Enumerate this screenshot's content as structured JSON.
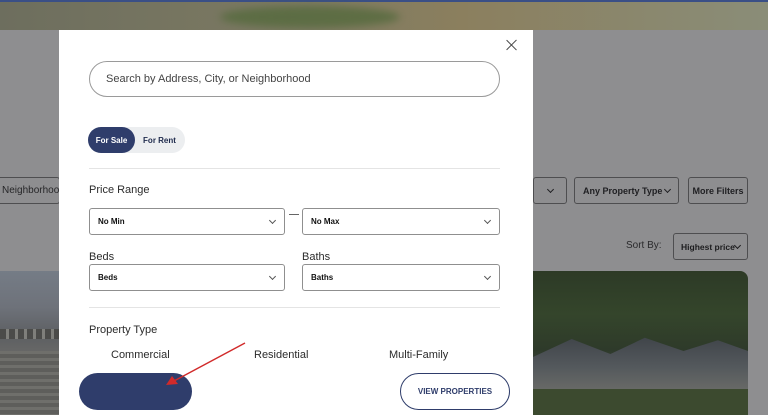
{
  "background": {
    "neighborhood_text": "Neighborhoo",
    "property_type_label": "Any Property Type",
    "more_filters_label": "More Filters",
    "sort_label": "Sort By:",
    "sort_value": "Highest price"
  },
  "modal": {
    "search_placeholder": "Search by Address, City, or Neighborhood",
    "listing_type": {
      "options": [
        "For Sale",
        "For Rent"
      ],
      "selected": "For Sale"
    },
    "price_range": {
      "label": "Price Range",
      "min_value": "No Min",
      "max_value": "No Max"
    },
    "beds": {
      "label": "Beds",
      "value": "Beds"
    },
    "baths": {
      "label": "Baths",
      "value": "Baths"
    },
    "property_type": {
      "label": "Property Type",
      "options": [
        "Commercial",
        "Residential",
        "Multi-Family"
      ]
    },
    "view_properties_label": "VIEW PROPERTIES"
  },
  "colors": {
    "accent": "#2f3d6b",
    "annotation_arrow": "#d12a2a",
    "overlay": "#8e8e90"
  }
}
